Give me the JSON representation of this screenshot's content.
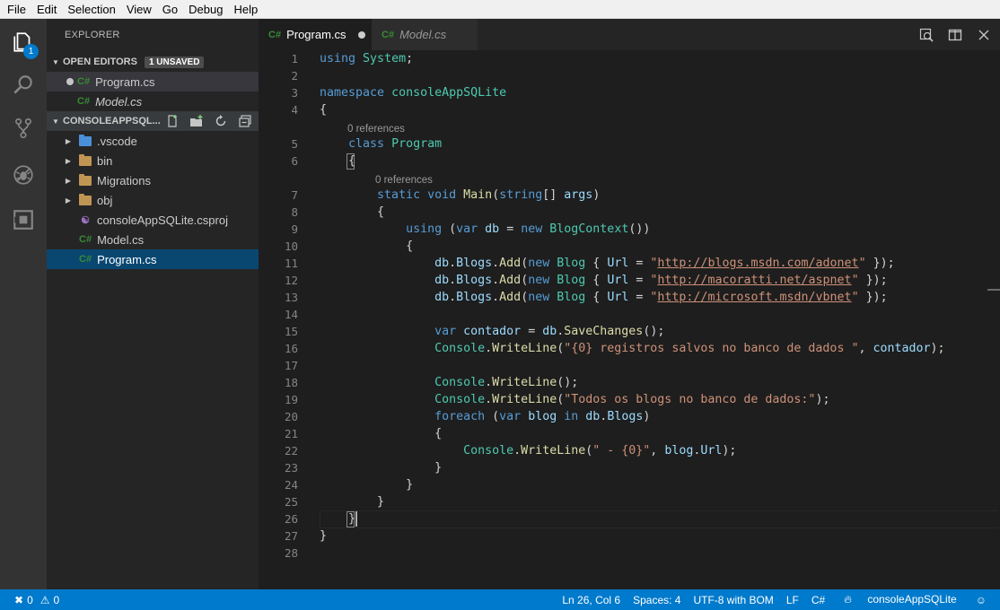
{
  "menu": [
    "File",
    "Edit",
    "Selection",
    "View",
    "Go",
    "Debug",
    "Help"
  ],
  "activity_bar": {
    "explorer_badge": "1"
  },
  "sidebar": {
    "title": "EXPLORER",
    "open_editors": {
      "header": "OPEN EDITORS",
      "badge": "1 UNSAVED",
      "items": [
        {
          "icon": "C#",
          "label": "Program.cs",
          "unsaved": true
        },
        {
          "icon": "C#",
          "label": "Model.cs",
          "italic": true
        }
      ]
    },
    "project": {
      "header": "CONSOLEAPPSQL...",
      "items": [
        {
          "label": ".vscode",
          "type": "folder-vscode"
        },
        {
          "label": "bin",
          "type": "folder"
        },
        {
          "label": "Migrations",
          "type": "folder"
        },
        {
          "label": "obj",
          "type": "folder"
        },
        {
          "label": "consoleAppSQLite.csproj",
          "type": "csproj"
        },
        {
          "label": "Model.cs",
          "type": "cs",
          "icon": "C#"
        },
        {
          "label": "Program.cs",
          "type": "cs",
          "icon": "C#",
          "selected": true
        }
      ]
    }
  },
  "tabs": [
    {
      "icon": "C#",
      "label": "Program.cs",
      "active": true,
      "dirty": true
    },
    {
      "icon": "C#",
      "label": "Model.cs",
      "active": false
    }
  ],
  "editor": {
    "references_lens": "0 references",
    "line_numbers": [
      "1",
      "2",
      "3",
      "4",
      "5",
      "6",
      "7",
      "8",
      "9",
      "10",
      "11",
      "12",
      "13",
      "14",
      "15",
      "16",
      "17",
      "18",
      "19",
      "20",
      "21",
      "22",
      "23",
      "24",
      "25",
      "26",
      "27",
      "28"
    ]
  },
  "statusbar": {
    "errors": "0",
    "warnings": "0",
    "position": "Ln 26, Col 6",
    "spaces": "Spaces: 4",
    "encoding": "UTF-8 with BOM",
    "eol": "LF",
    "language": "C#",
    "project": "consoleAppSQLite"
  },
  "colors": {
    "statusbar": "#007acc",
    "activity_bar": "#333333",
    "sidebar": "#252526",
    "editor": "#1e1e1e",
    "selection": "#094771"
  }
}
